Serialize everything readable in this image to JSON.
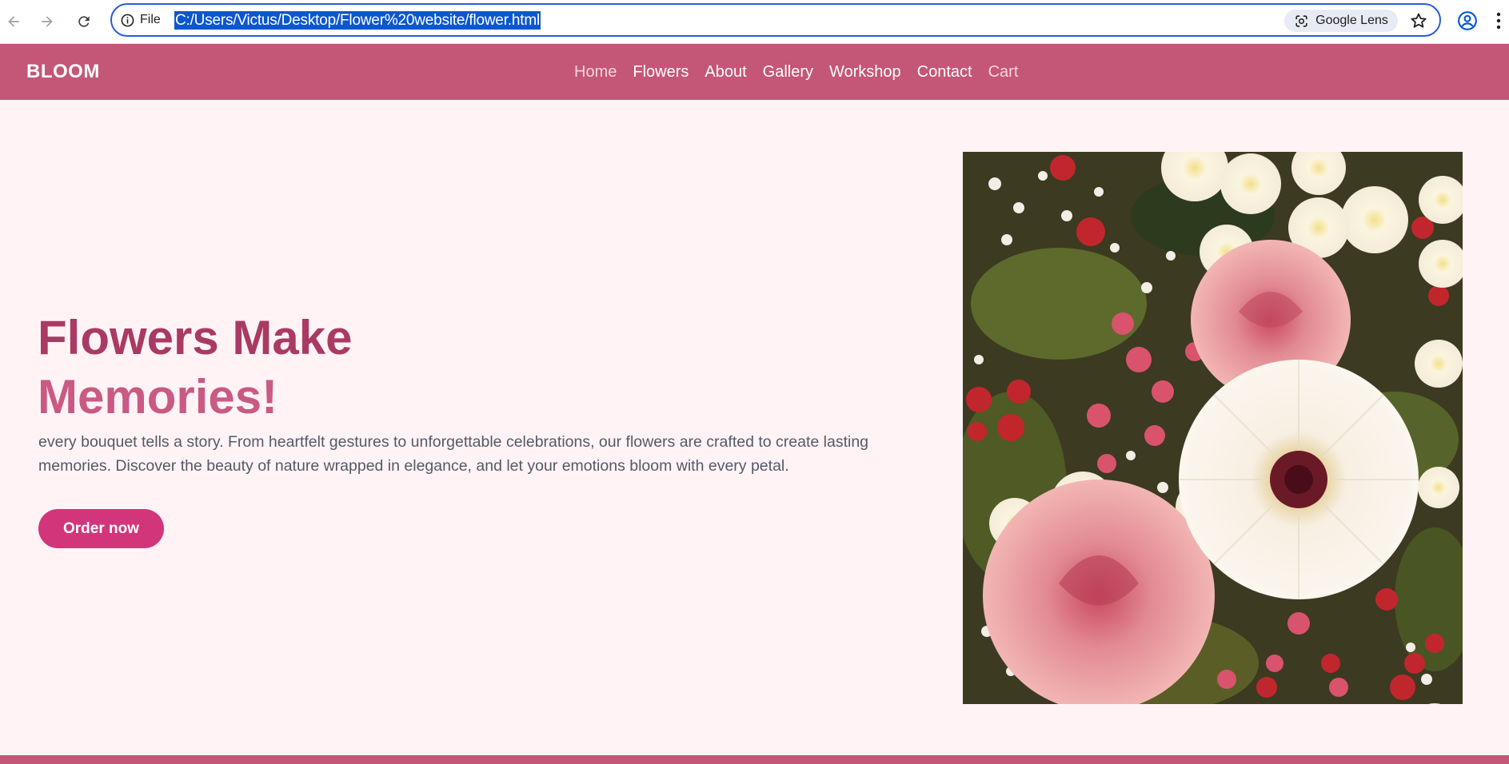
{
  "browser": {
    "site_info_label": "File",
    "url": "C:/Users/Victus/Desktop/Flower%20website/flower.html",
    "lens_label": "Google Lens"
  },
  "site": {
    "logo": "BLOOM",
    "nav": [
      "Home",
      "Flowers",
      "About",
      "Gallery",
      "Workshop",
      "Contact",
      "Cart"
    ],
    "colors": {
      "brand": "#c45677",
      "accent": "#d2357a",
      "background": "#fff3f6"
    }
  },
  "hero": {
    "title_line1": "Flowers Make",
    "title_line2": "Memories!",
    "text": "every bouquet tells a story. From heartfelt gestures to unforgettable celebrations, our flowers are crafted to create lasting memories. Discover the beauty of nature wrapped in elegance, and let your emotions bloom with every petal.",
    "button": "Order now",
    "image_icon": "flower-bouquet-photo"
  }
}
